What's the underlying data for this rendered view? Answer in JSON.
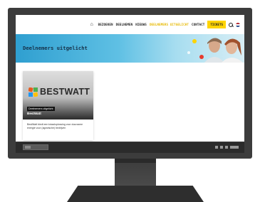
{
  "nav": {
    "items": [
      "BEZOEKEN",
      "DEELNEMEN",
      "NIEUWS",
      "DEELNEMERS UITGELICHT",
      "CONTACT"
    ],
    "active_index": 3,
    "tickets_label": "TICKETS",
    "icons": [
      "home-icon",
      "search-icon",
      "flag-nl-icon"
    ]
  },
  "hero": {
    "title": "Deelnemers uitgelicht"
  },
  "card": {
    "logo_text": "BESTWATT",
    "badge": "Deelnemers uitgelicht",
    "name": "BestWatt",
    "description": "BestWatt biedt een totaaloplossing voor duurzame energie voor (agrarische) bedrijven"
  },
  "colors": {
    "accent": "#ffd400",
    "hero_blue": "#2f9fd0",
    "monitor": "#3c3c3c"
  }
}
